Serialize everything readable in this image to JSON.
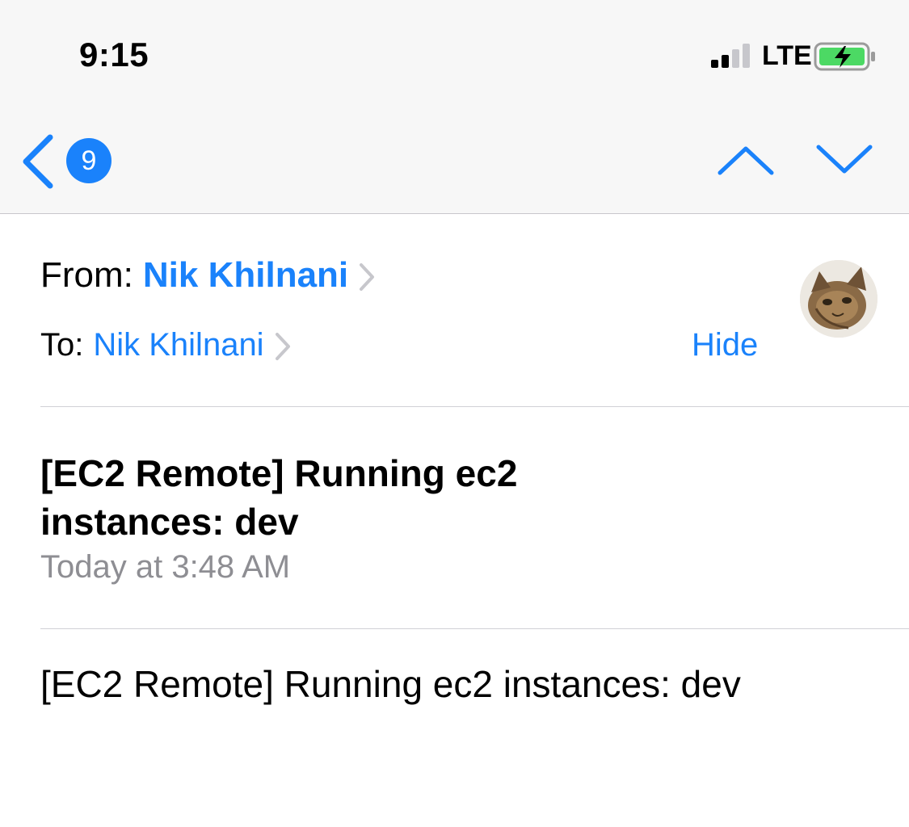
{
  "status_bar": {
    "time": "9:15",
    "network": "LTE",
    "signal_bars_filled": 2,
    "signal_bars_total": 4,
    "battery_charging": true,
    "battery_color": "#4cd964"
  },
  "nav": {
    "back_icon": "chevron-left-icon",
    "unread_count": "9",
    "prev_icon": "chevron-up-icon",
    "next_icon": "chevron-down-icon"
  },
  "header": {
    "from_label": "From:",
    "from_name": "Nik Khilnani",
    "to_label": "To:",
    "to_name": "Nik Khilnani",
    "hide_label": "Hide",
    "avatar_icon": "cat-avatar"
  },
  "message": {
    "subject": "[EC2 Remote] Running ec2 instances: dev",
    "date": "Today at 3:48 AM",
    "body": "[EC2 Remote] Running ec2 instances: dev"
  },
  "colors": {
    "accent": "#1a82fb",
    "secondary_text": "#8e8e93",
    "nav_background": "#f7f7f7"
  }
}
